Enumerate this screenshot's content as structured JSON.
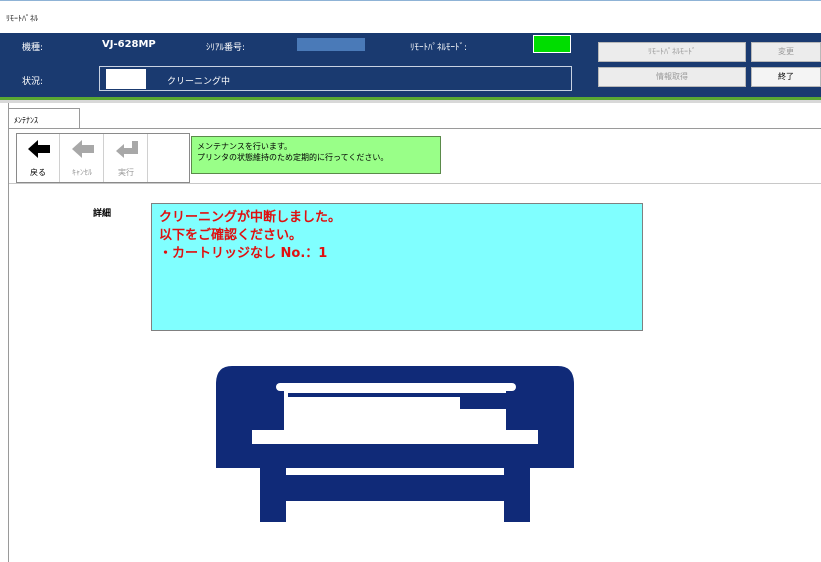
{
  "window": {
    "title": "ﾘﾓｰﾄﾊﾟﾈﾙ"
  },
  "header": {
    "model_label": "機種:",
    "model_value": "VJ-628MP",
    "serial_label": "ｼﾘｱﾙ番号:",
    "remote_mode_label": "ﾘﾓｰﾄﾊﾟﾈﾙﾓｰﾄﾞ:",
    "remote_mode_color": "#00dd00",
    "status_label": "状況:",
    "status_text": "クリーニング中",
    "buttons": {
      "remote_panel_mode": "ﾘﾓｰﾄﾊﾟﾈﾙﾓｰﾄﾞ",
      "change": "変更",
      "get_info": "情報取得",
      "exit": "終了"
    },
    "header_color": "#1a3a70"
  },
  "tabs": [
    {
      "label": "ﾒﾝﾃﾅﾝｽ"
    }
  ],
  "toolbar": {
    "back": "戻る",
    "cancel": "ｷｬﾝｾﾙ",
    "execute": "実行",
    "info_lines": [
      "メンテナンスを行います。",
      "プリンタの状態維持のため定期的に行ってください。"
    ],
    "info_color": "#99ff88"
  },
  "detail": {
    "label": "詳細",
    "lines": [
      "クリーニングが中断しました。",
      "以下をご確認ください。",
      "・カートリッジなし No.：1"
    ],
    "bg_color": "#80ffff",
    "text_color": "#e01010"
  },
  "printer_icon": {
    "name": "printer-icon",
    "color": "#102a78"
  }
}
